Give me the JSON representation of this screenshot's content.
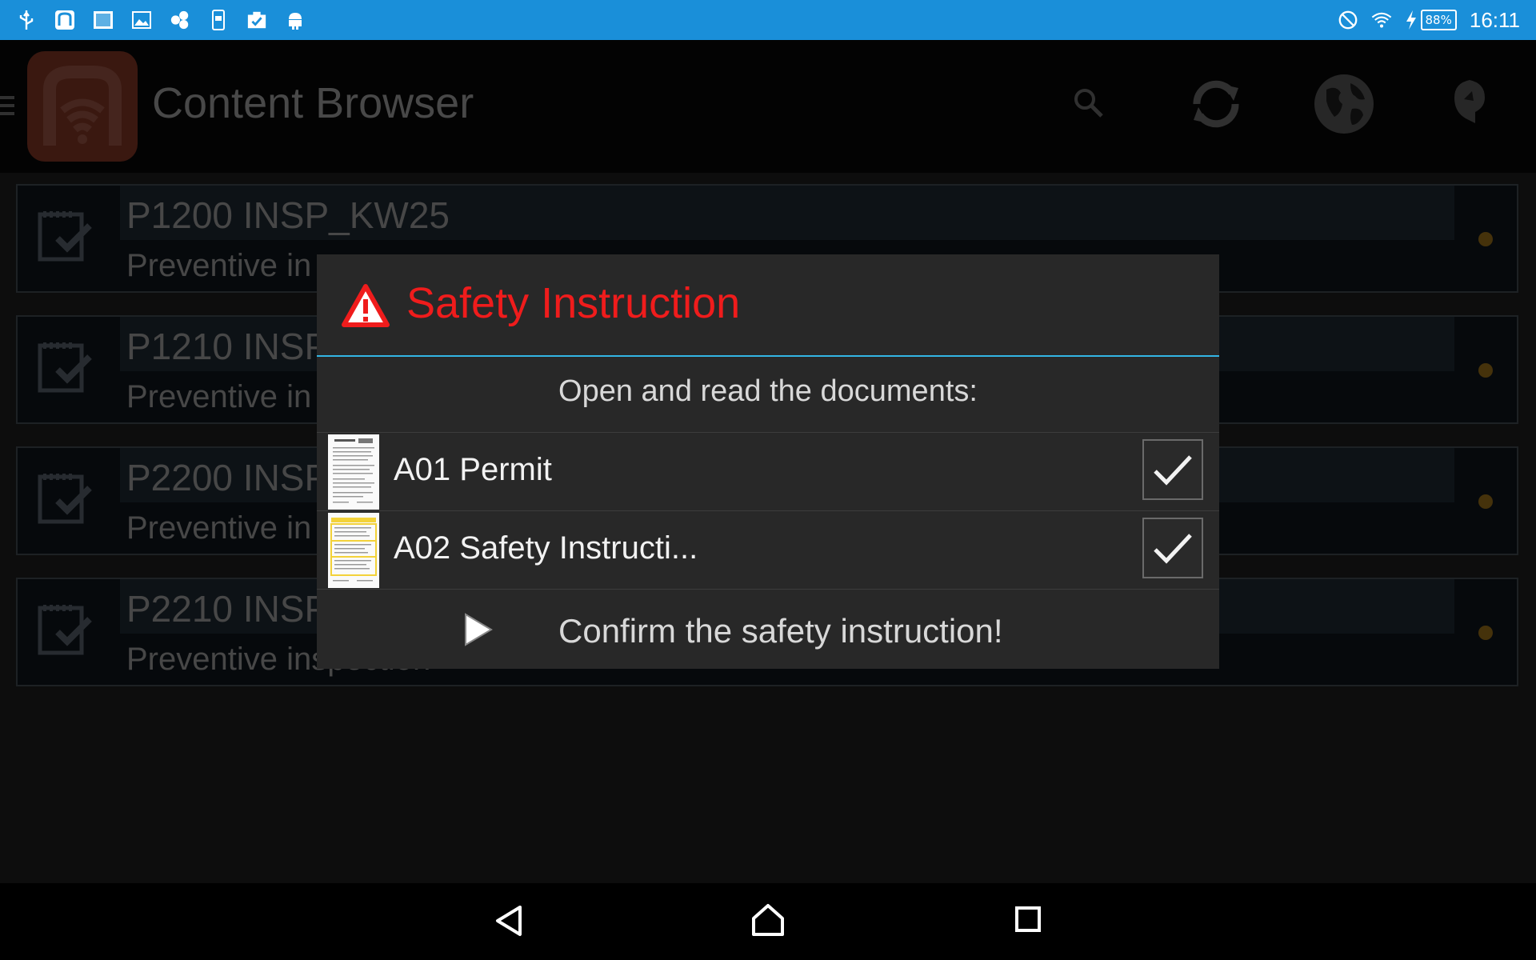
{
  "status_bar": {
    "icons": [
      "usb-icon",
      "app-notification-icon",
      "screenshot-icon",
      "image-icon",
      "cluster-icon",
      "device-icon",
      "checklist-icon",
      "android-icon"
    ],
    "battery": "88%",
    "time": "16:11",
    "colors": {
      "background": "#1a8fd9"
    }
  },
  "action_bar": {
    "title": "Content Browser",
    "actions": [
      "search-icon",
      "sync-icon",
      "globe-icon",
      "settings-icon"
    ]
  },
  "list": {
    "items": [
      {
        "title": "P1200 INSP_KW25",
        "subtitle": "Preventive in"
      },
      {
        "title": "P1210 INSP",
        "subtitle": "Preventive in"
      },
      {
        "title": "P2200 INSP",
        "subtitle": "Preventive in"
      },
      {
        "title": "P2210 INSP",
        "subtitle": "Preventive inspection"
      }
    ]
  },
  "dialog": {
    "title": "Safety Instruction",
    "message": "Open and read the documents:",
    "documents": [
      {
        "label": "A01 Permit",
        "checked": true
      },
      {
        "label": "A02 Safety Instructi...",
        "checked": true
      }
    ],
    "confirm_label": "Confirm the safety instruction!",
    "colors": {
      "title": "#ef1c1c",
      "divider": "#33b5e5"
    }
  },
  "nav_bar": {
    "buttons": [
      "back-icon",
      "home-icon",
      "recents-icon"
    ]
  }
}
